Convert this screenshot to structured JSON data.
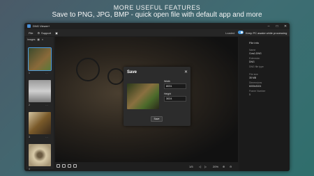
{
  "promo": {
    "title": "MORE USEFUL FEATURES",
    "subtitle": "Save to PNG, JPG, BMP - quick open file with default app and more"
  },
  "window": {
    "title": "DNG Viewer+",
    "controls": [
      "–",
      "□",
      "✕"
    ]
  },
  "menu": {
    "file": "File",
    "support": "Support",
    "status": "Loaded",
    "keep_awake_label": "Keep PC awake while processing",
    "keep_awake_on": true
  },
  "sidebar": {
    "header": "Images",
    "thumbnails": [
      {
        "index": "1",
        "colors": [
          "#3b4a2c",
          "#8a6a3a"
        ],
        "selected": true
      },
      {
        "index": "2",
        "colors": [
          "#888888",
          "#cccccc"
        ],
        "selected": false
      },
      {
        "index": "3",
        "colors": [
          "#7a5a2a",
          "#d4c4a0"
        ],
        "selected": false
      },
      {
        "index": "4",
        "colors": [
          "#c9b89a",
          "#6a5a40"
        ],
        "selected": false
      }
    ]
  },
  "bottombar": {
    "position": "1/5",
    "zoom": "20%"
  },
  "info": {
    "header": "File info",
    "name_label": "Name",
    "name": "Cow1.DNG",
    "ext_label": "Extension",
    "ext": "DNG",
    "type_label": "DNG file type",
    "size_label": "File size",
    "size": "35 MB",
    "dimensions_label": "Dimensions",
    "dimensions": "6000x3024",
    "frame_label": "Frame Number",
    "frame": "1"
  },
  "dialog": {
    "title": "Save",
    "close": "✕",
    "width_label": "Width",
    "width_value": "8031",
    "height_label": "Height",
    "height_value": "3024",
    "save_label": "Save"
  },
  "colors": {
    "accent": "#4a9be0",
    "background": "#1e1e1e"
  }
}
